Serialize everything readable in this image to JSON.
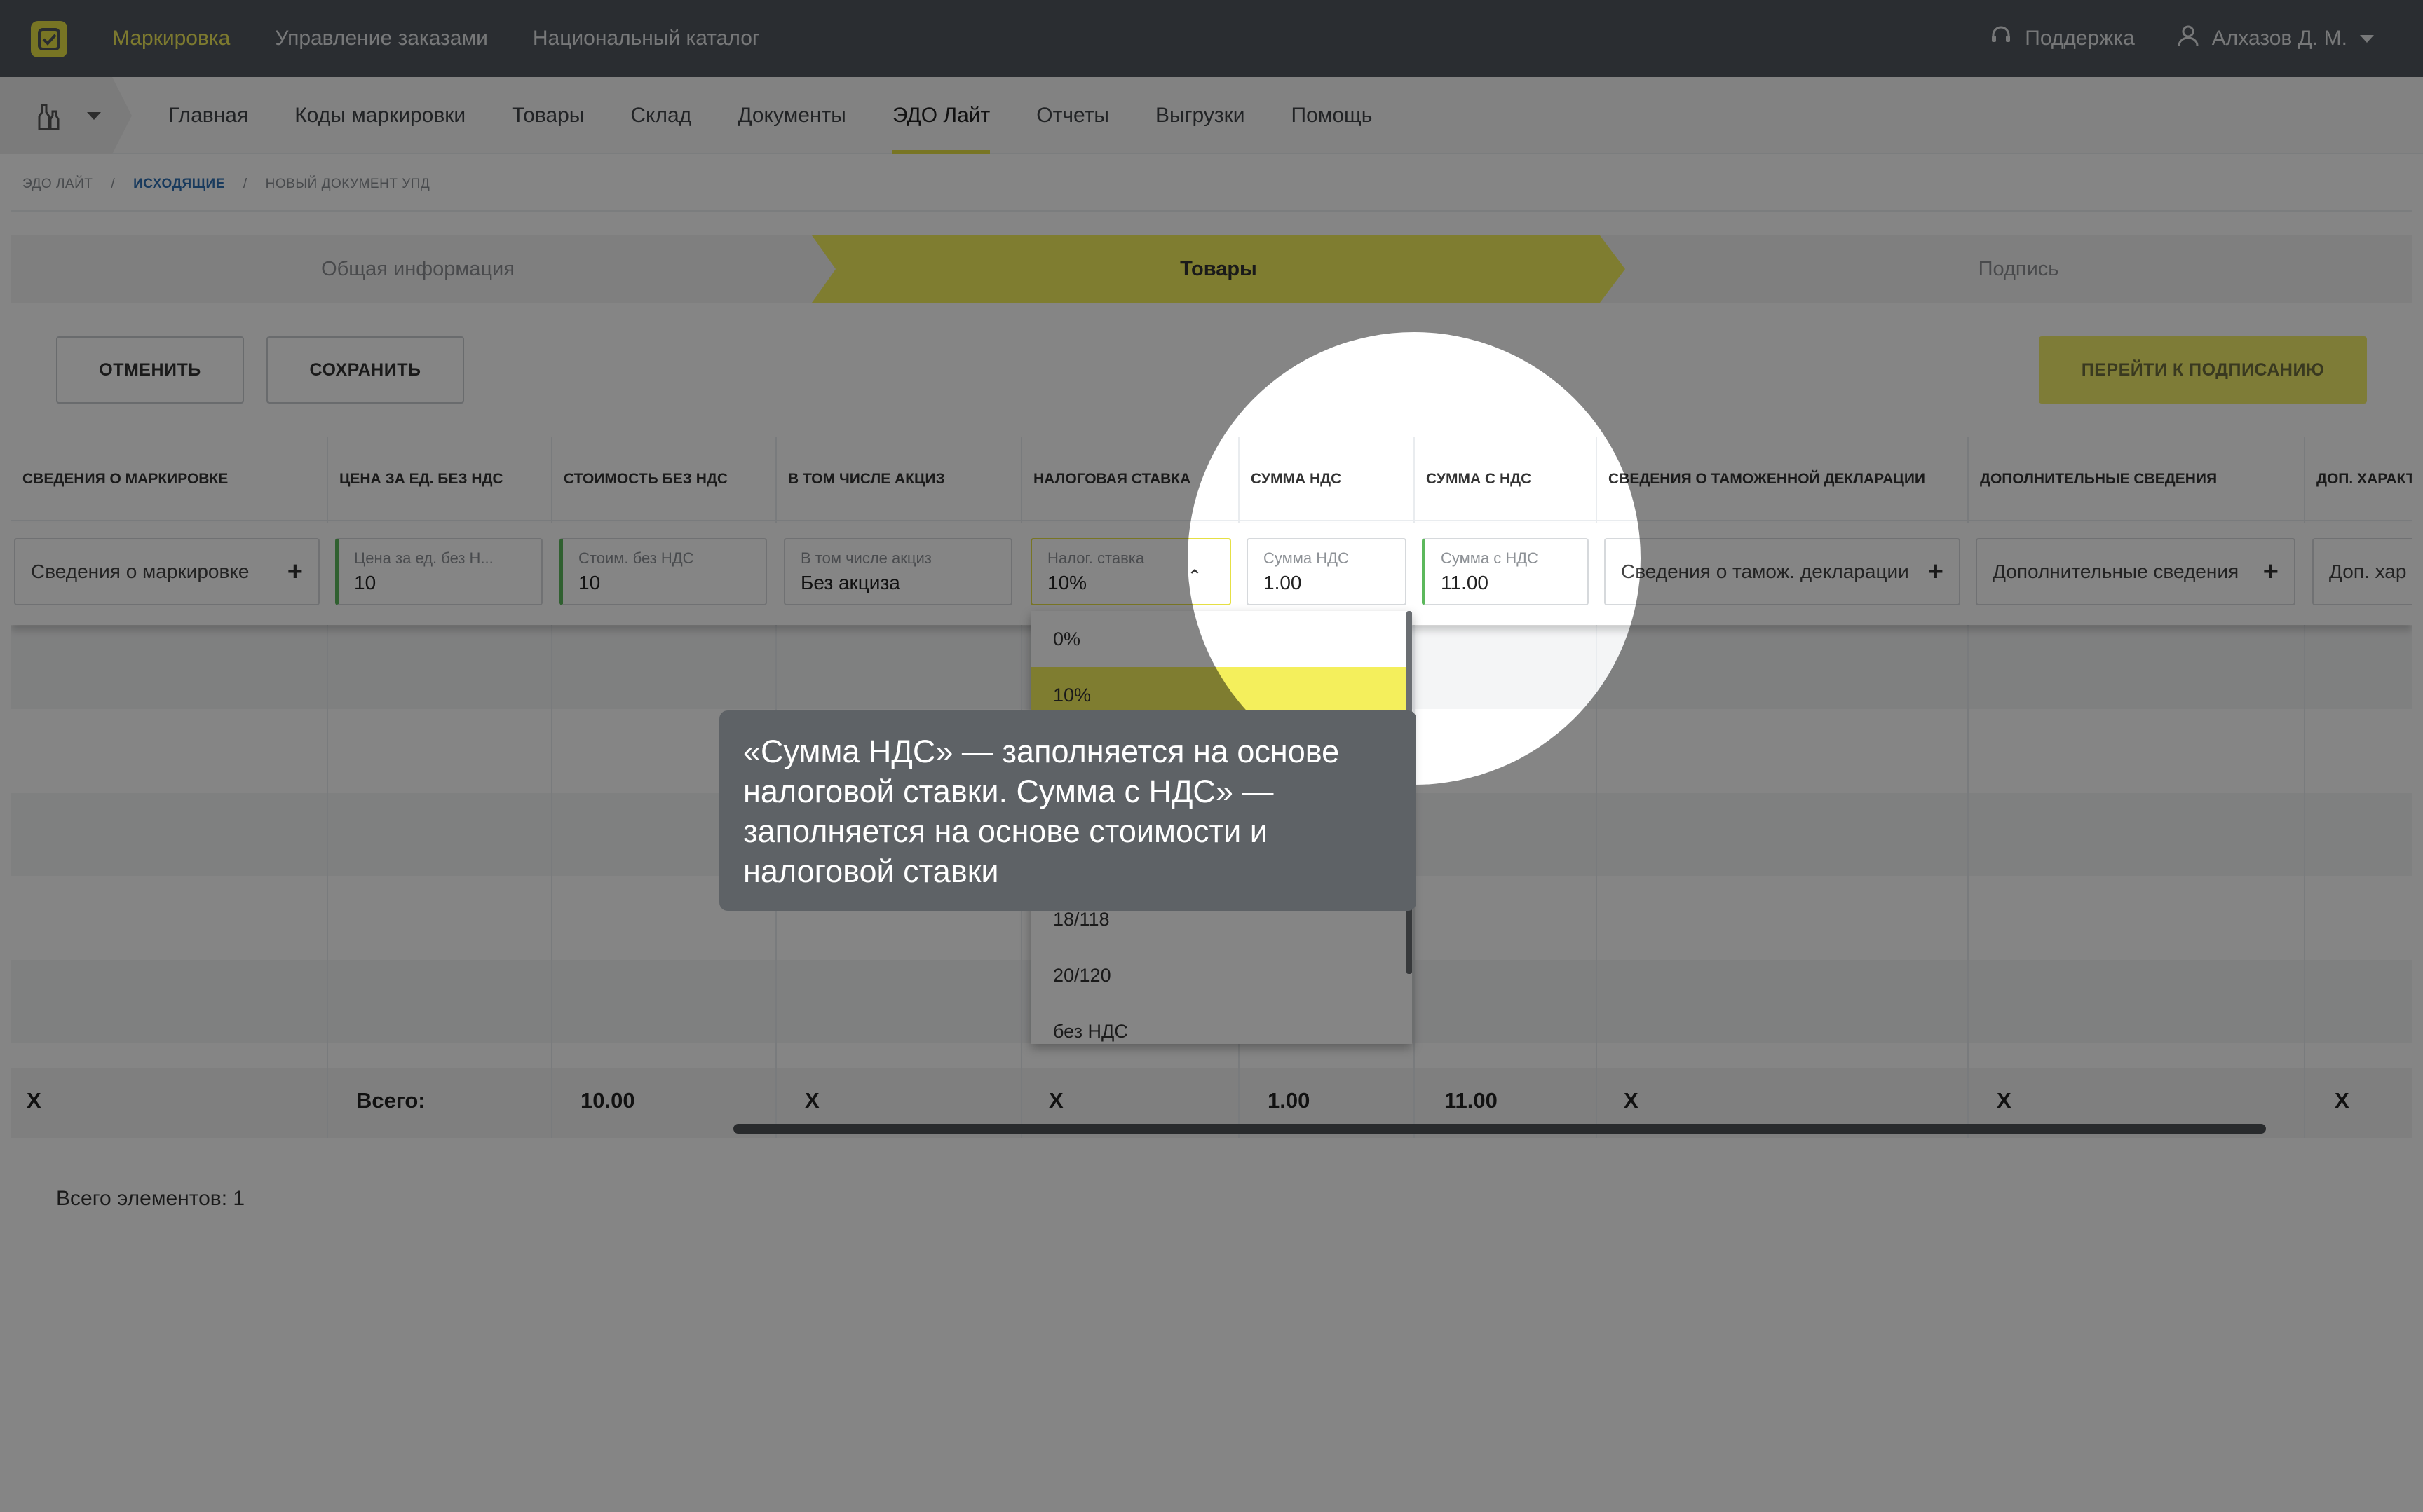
{
  "top_nav": {
    "items": [
      "Маркировка",
      "Управление заказами",
      "Национальный каталог"
    ],
    "support": "Поддержка",
    "user": "Алхазов Д. М."
  },
  "main_nav": {
    "items": [
      "Главная",
      "Коды маркировки",
      "Товары",
      "Склад",
      "Документы",
      "ЭДО Лайт",
      "Отчеты",
      "Выгрузки",
      "Помощь"
    ],
    "active": "ЭДО Лайт"
  },
  "breadcrumb": [
    "эдо лайт",
    "/",
    "исходящие",
    "/",
    "новый документ упд"
  ],
  "stepper": [
    "Общая информация",
    "Товары",
    "Подпись"
  ],
  "toolbar": {
    "cancel": "ОТМЕНИТЬ",
    "save": "СОХРАНИТЬ",
    "next": "ПЕРЕЙТИ К ПОДПИСАНИЮ"
  },
  "table": {
    "headers": [
      "СВЕДЕНИЯ О МАРКИРОВКЕ",
      "ЦЕНА ЗА ЕД. БЕЗ НДС",
      "СТОИМОСТЬ БЕЗ НДС",
      "В ТОМ ЧИСЛЕ АКЦИЗ",
      "НАЛОГОВАЯ СТАВКА",
      "СУММА НДС",
      "СУММА С НДС",
      "СВЕДЕНИЯ О ТАМОЖЕННОЙ ДЕКЛАРАЦИИ",
      "ДОПОЛНИТЕЛЬНЫЕ СВЕДЕНИЯ",
      "ДОП. ХАРАКТ"
    ],
    "row": {
      "marking": "Сведения о маркировке",
      "price_label": "Цена за ед. без Н...",
      "price_value": "10",
      "cost_label": "Стоим. без НДС",
      "cost_value": "10",
      "excise_label": "В том числе акциз",
      "excise_value": "Без акциза",
      "rate_label": "Налог. ставка",
      "rate_value": "10%",
      "vat_label": "Сумма НДС",
      "vat_value": "1.00",
      "total_label": "Сумма с НДС",
      "total_value": "11.00",
      "customs": "Сведения о тамож. декларации",
      "extra": "Дополнительные сведения",
      "extra2": "Доп. хар"
    },
    "totals": [
      "X",
      "Всего:",
      "10.00",
      "X",
      "X",
      "1.00",
      "11.00",
      "X",
      "X",
      "X"
    ]
  },
  "dropdown": {
    "options": [
      "0%",
      "10%",
      "18/118",
      "20/120",
      "без НДС"
    ],
    "selected": "10%"
  },
  "footer": {
    "count": "Всего элементов: 1"
  },
  "tooltip": "«Сумма НДС» — заполняется на основе налоговой ставки. Сумма с НДС» — заполняется на основе стоимости и налоговой ставки",
  "colors": {
    "topbar": "#51575e",
    "accent": "#f4ef5c",
    "valid": "#5cb85c"
  }
}
